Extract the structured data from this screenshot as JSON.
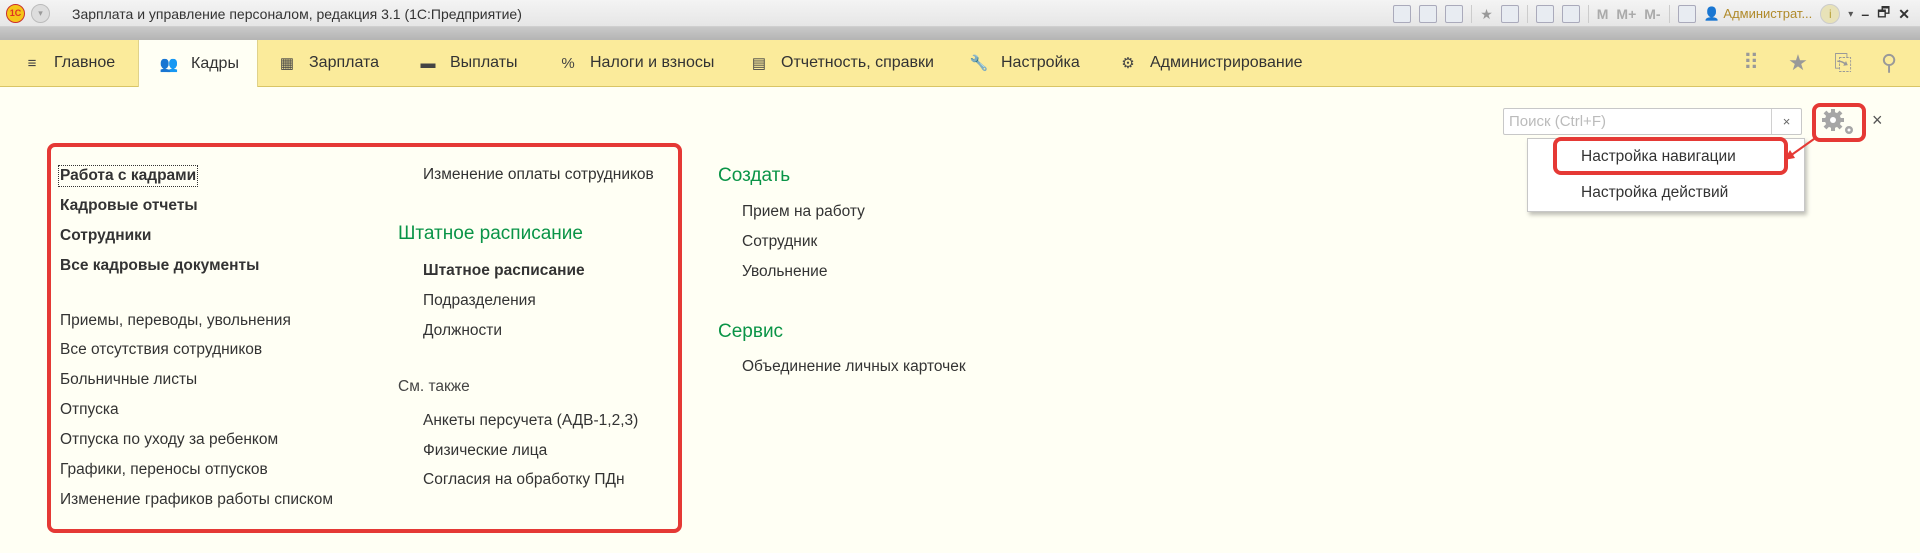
{
  "window": {
    "title": "Зарплата и управление персоналом, редакция 3.1  (1С:Предприятие)",
    "logo": "1С",
    "user": "Администрат...",
    "memory_buttons": [
      "M",
      "M+",
      "M-"
    ]
  },
  "nav": {
    "items": [
      {
        "label": "Главное",
        "icon": "menu-icon"
      },
      {
        "label": "Кадры",
        "icon": "people-icon",
        "active": true
      },
      {
        "label": "Зарплата",
        "icon": "calculator-icon"
      },
      {
        "label": "Выплаты",
        "icon": "wallet-icon"
      },
      {
        "label": "Налоги и взносы",
        "icon": "percent-icon"
      },
      {
        "label": "Отчетность, справки",
        "icon": "documents-icon"
      },
      {
        "label": "Настройка",
        "icon": "wrench-icon"
      },
      {
        "label": "Администрирование",
        "icon": "gear-icon"
      }
    ]
  },
  "search": {
    "placeholder": "Поиск (Ctrl+F)",
    "value": "",
    "clear": "×"
  },
  "close": "×",
  "settings_menu": {
    "items": [
      "Настройка навигации",
      "Настройка действий"
    ],
    "highlighted": 0
  },
  "col1": {
    "bold": [
      "Работа с кадрами",
      "Кадровые отчеты",
      "Сотрудники",
      "Все кадровые документы"
    ],
    "items": [
      "Приемы, переводы, увольнения",
      "Все отсутствия сотрудников",
      "Больничные листы",
      "Отпуска",
      "Отпуска по уходу за ребенком",
      "Графики, переносы отпусков",
      "Изменение графиков работы списком"
    ]
  },
  "col2": {
    "top": "Изменение оплаты сотрудников",
    "group": "Штатное расписание",
    "group_items": [
      "Штатное расписание",
      "Подразделения",
      "Должности"
    ],
    "see_also": "См. также",
    "see_also_items": [
      "Анкеты персучета (АДВ-1,2,3)",
      "Физические лица",
      "Согласия на обработку ПДн"
    ]
  },
  "col3": {
    "create": "Создать",
    "create_items": [
      "Прием на работу",
      "Сотрудник",
      "Увольнение"
    ],
    "service": "Сервис",
    "service_items": [
      "Объединение личных карточек"
    ]
  },
  "colors": {
    "accent_green": "#0a9447",
    "nav_bg": "#fbeb9b",
    "highlight_red": "#e53935"
  }
}
